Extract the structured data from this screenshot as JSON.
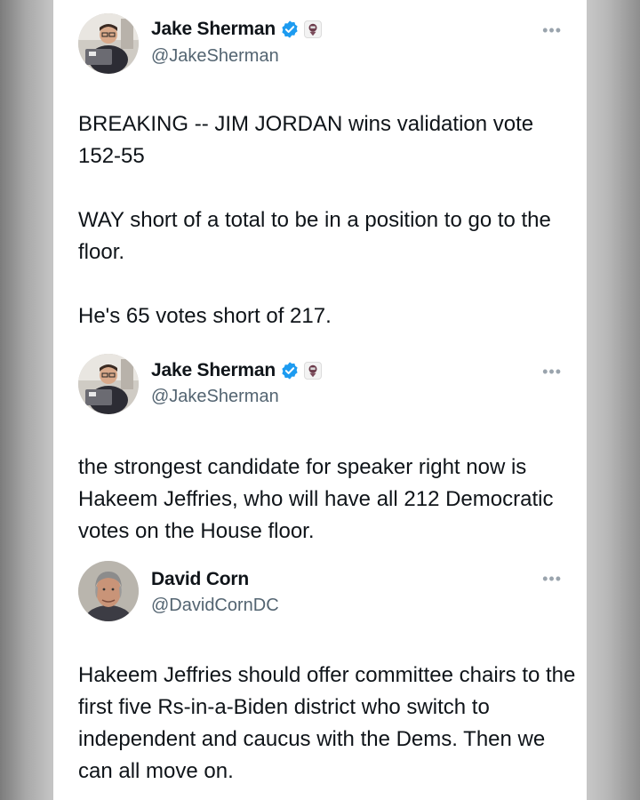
{
  "tweets": [
    {
      "author_name": "Jake Sherman",
      "handle": "@JakeSherman",
      "verified": true,
      "more_label": "•••",
      "avatar_icon": "profile-photo-man-glasses-laptop",
      "paragraphs": [
        "BREAKING -- JIM JORDAN wins validation vote 152-55",
        "WAY short of a total to be in a position to go to the floor.",
        "He's 65 votes short of 217."
      ]
    },
    {
      "author_name": "Jake Sherman",
      "handle": "@JakeSherman",
      "verified": true,
      "more_label": "•••",
      "avatar_icon": "profile-photo-man-glasses-laptop",
      "paragraphs": [
        "the strongest candidate for speaker right now is Hakeem Jeffries, who will have all 212 Democratic votes on the House floor."
      ]
    },
    {
      "author_name": "David Corn",
      "handle": "@DavidCornDC",
      "verified": false,
      "more_label": "•••",
      "avatar_icon": "profile-photo-gray-haired-man",
      "paragraphs": [
        "Hakeem Jeffries should offer committee chairs to the first five Rs-in-a-Biden district who switch to independent and caucus with the Dems. Then we can all move on."
      ]
    }
  ],
  "colors": {
    "verified_blue": "#1d9bf0",
    "text": "#0f1419",
    "secondary_text": "#536471",
    "background": "#ffffff"
  }
}
